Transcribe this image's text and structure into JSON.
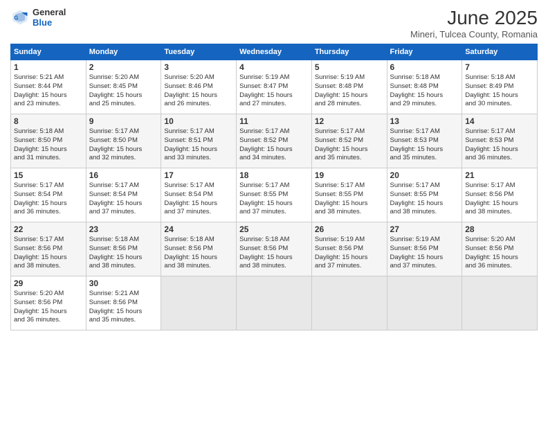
{
  "header": {
    "logo_general": "General",
    "logo_blue": "Blue",
    "month": "June 2025",
    "location": "Mineri, Tulcea County, Romania"
  },
  "days_of_week": [
    "Sunday",
    "Monday",
    "Tuesday",
    "Wednesday",
    "Thursday",
    "Friday",
    "Saturday"
  ],
  "weeks": [
    [
      {
        "day": 1,
        "info": "Sunrise: 5:21 AM\nSunset: 8:44 PM\nDaylight: 15 hours\nand 23 minutes."
      },
      {
        "day": 2,
        "info": "Sunrise: 5:20 AM\nSunset: 8:45 PM\nDaylight: 15 hours\nand 25 minutes."
      },
      {
        "day": 3,
        "info": "Sunrise: 5:20 AM\nSunset: 8:46 PM\nDaylight: 15 hours\nand 26 minutes."
      },
      {
        "day": 4,
        "info": "Sunrise: 5:19 AM\nSunset: 8:47 PM\nDaylight: 15 hours\nand 27 minutes."
      },
      {
        "day": 5,
        "info": "Sunrise: 5:19 AM\nSunset: 8:48 PM\nDaylight: 15 hours\nand 28 minutes."
      },
      {
        "day": 6,
        "info": "Sunrise: 5:18 AM\nSunset: 8:48 PM\nDaylight: 15 hours\nand 29 minutes."
      },
      {
        "day": 7,
        "info": "Sunrise: 5:18 AM\nSunset: 8:49 PM\nDaylight: 15 hours\nand 30 minutes."
      }
    ],
    [
      {
        "day": 8,
        "info": "Sunrise: 5:18 AM\nSunset: 8:50 PM\nDaylight: 15 hours\nand 31 minutes."
      },
      {
        "day": 9,
        "info": "Sunrise: 5:17 AM\nSunset: 8:50 PM\nDaylight: 15 hours\nand 32 minutes."
      },
      {
        "day": 10,
        "info": "Sunrise: 5:17 AM\nSunset: 8:51 PM\nDaylight: 15 hours\nand 33 minutes."
      },
      {
        "day": 11,
        "info": "Sunrise: 5:17 AM\nSunset: 8:52 PM\nDaylight: 15 hours\nand 34 minutes."
      },
      {
        "day": 12,
        "info": "Sunrise: 5:17 AM\nSunset: 8:52 PM\nDaylight: 15 hours\nand 35 minutes."
      },
      {
        "day": 13,
        "info": "Sunrise: 5:17 AM\nSunset: 8:53 PM\nDaylight: 15 hours\nand 35 minutes."
      },
      {
        "day": 14,
        "info": "Sunrise: 5:17 AM\nSunset: 8:53 PM\nDaylight: 15 hours\nand 36 minutes."
      }
    ],
    [
      {
        "day": 15,
        "info": "Sunrise: 5:17 AM\nSunset: 8:54 PM\nDaylight: 15 hours\nand 36 minutes."
      },
      {
        "day": 16,
        "info": "Sunrise: 5:17 AM\nSunset: 8:54 PM\nDaylight: 15 hours\nand 37 minutes."
      },
      {
        "day": 17,
        "info": "Sunrise: 5:17 AM\nSunset: 8:54 PM\nDaylight: 15 hours\nand 37 minutes."
      },
      {
        "day": 18,
        "info": "Sunrise: 5:17 AM\nSunset: 8:55 PM\nDaylight: 15 hours\nand 37 minutes."
      },
      {
        "day": 19,
        "info": "Sunrise: 5:17 AM\nSunset: 8:55 PM\nDaylight: 15 hours\nand 38 minutes."
      },
      {
        "day": 20,
        "info": "Sunrise: 5:17 AM\nSunset: 8:55 PM\nDaylight: 15 hours\nand 38 minutes."
      },
      {
        "day": 21,
        "info": "Sunrise: 5:17 AM\nSunset: 8:56 PM\nDaylight: 15 hours\nand 38 minutes."
      }
    ],
    [
      {
        "day": 22,
        "info": "Sunrise: 5:17 AM\nSunset: 8:56 PM\nDaylight: 15 hours\nand 38 minutes."
      },
      {
        "day": 23,
        "info": "Sunrise: 5:18 AM\nSunset: 8:56 PM\nDaylight: 15 hours\nand 38 minutes."
      },
      {
        "day": 24,
        "info": "Sunrise: 5:18 AM\nSunset: 8:56 PM\nDaylight: 15 hours\nand 38 minutes."
      },
      {
        "day": 25,
        "info": "Sunrise: 5:18 AM\nSunset: 8:56 PM\nDaylight: 15 hours\nand 38 minutes."
      },
      {
        "day": 26,
        "info": "Sunrise: 5:19 AM\nSunset: 8:56 PM\nDaylight: 15 hours\nand 37 minutes."
      },
      {
        "day": 27,
        "info": "Sunrise: 5:19 AM\nSunset: 8:56 PM\nDaylight: 15 hours\nand 37 minutes."
      },
      {
        "day": 28,
        "info": "Sunrise: 5:20 AM\nSunset: 8:56 PM\nDaylight: 15 hours\nand 36 minutes."
      }
    ],
    [
      {
        "day": 29,
        "info": "Sunrise: 5:20 AM\nSunset: 8:56 PM\nDaylight: 15 hours\nand 36 minutes."
      },
      {
        "day": 30,
        "info": "Sunrise: 5:21 AM\nSunset: 8:56 PM\nDaylight: 15 hours\nand 35 minutes."
      },
      null,
      null,
      null,
      null,
      null
    ]
  ]
}
